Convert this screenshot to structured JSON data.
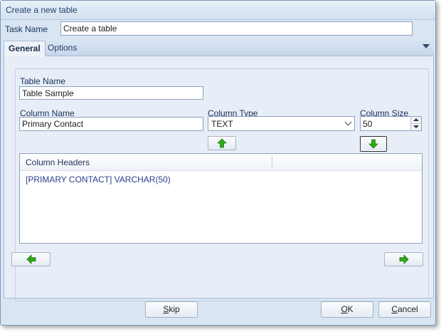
{
  "window": {
    "title": "Create  a new table"
  },
  "task": {
    "label": "Task Name",
    "value": "Create a table"
  },
  "tabs": [
    {
      "label": "General"
    },
    {
      "label": "Options"
    }
  ],
  "table_name": {
    "label": "Table Name",
    "value": "Table Sample"
  },
  "column_name": {
    "label": "Column Name",
    "value": "Primary Contact"
  },
  "column_type": {
    "label": "Column Type",
    "value": "TEXT"
  },
  "column_size": {
    "label": "Column Size",
    "value": "50"
  },
  "list": {
    "headers": [
      "Column Headers",
      ""
    ],
    "rows": [
      "[PRIMARY CONTACT] VARCHAR(50)"
    ]
  },
  "footer": {
    "skip": {
      "accel": "S",
      "rest": "kip"
    },
    "ok": {
      "accel": "O",
      "rest": "K"
    },
    "cancel": {
      "accel": "C",
      "rest": "ancel"
    }
  },
  "colors": {
    "accent_green": "#2faa16",
    "label_blue": "#14305a",
    "row_blue": "#2a3f8a"
  },
  "icons": [
    "arrow-up-icon",
    "arrow-down-icon",
    "arrow-left-icon",
    "arrow-right-icon",
    "chevron-down-icon"
  ]
}
